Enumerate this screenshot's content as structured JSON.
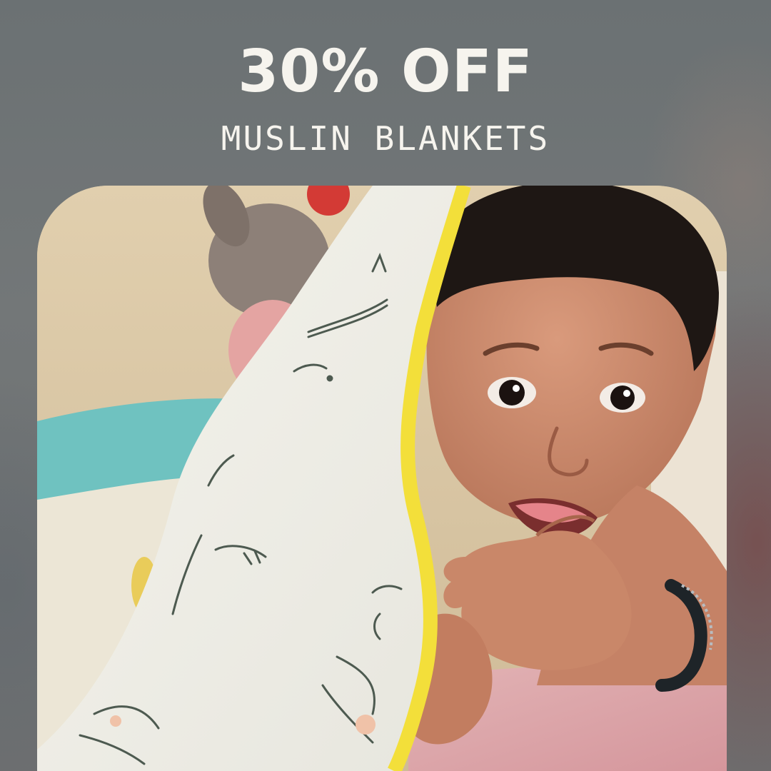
{
  "promo": {
    "discount": "30% OFF",
    "product": "MUSLIN BLANKETS"
  },
  "photo": {
    "subject": "smiling-baby-under-muslin-blanket"
  },
  "colors": {
    "text": "#f6f4ee",
    "background": "#6f7577",
    "blanket_trim": "#f3df3a",
    "blanket": "#f2f1ea",
    "skin": "#c9876a",
    "hair": "#1e1714",
    "pink_sheet": "#dca2a7",
    "teal_pillow": "#6fc2c0"
  }
}
